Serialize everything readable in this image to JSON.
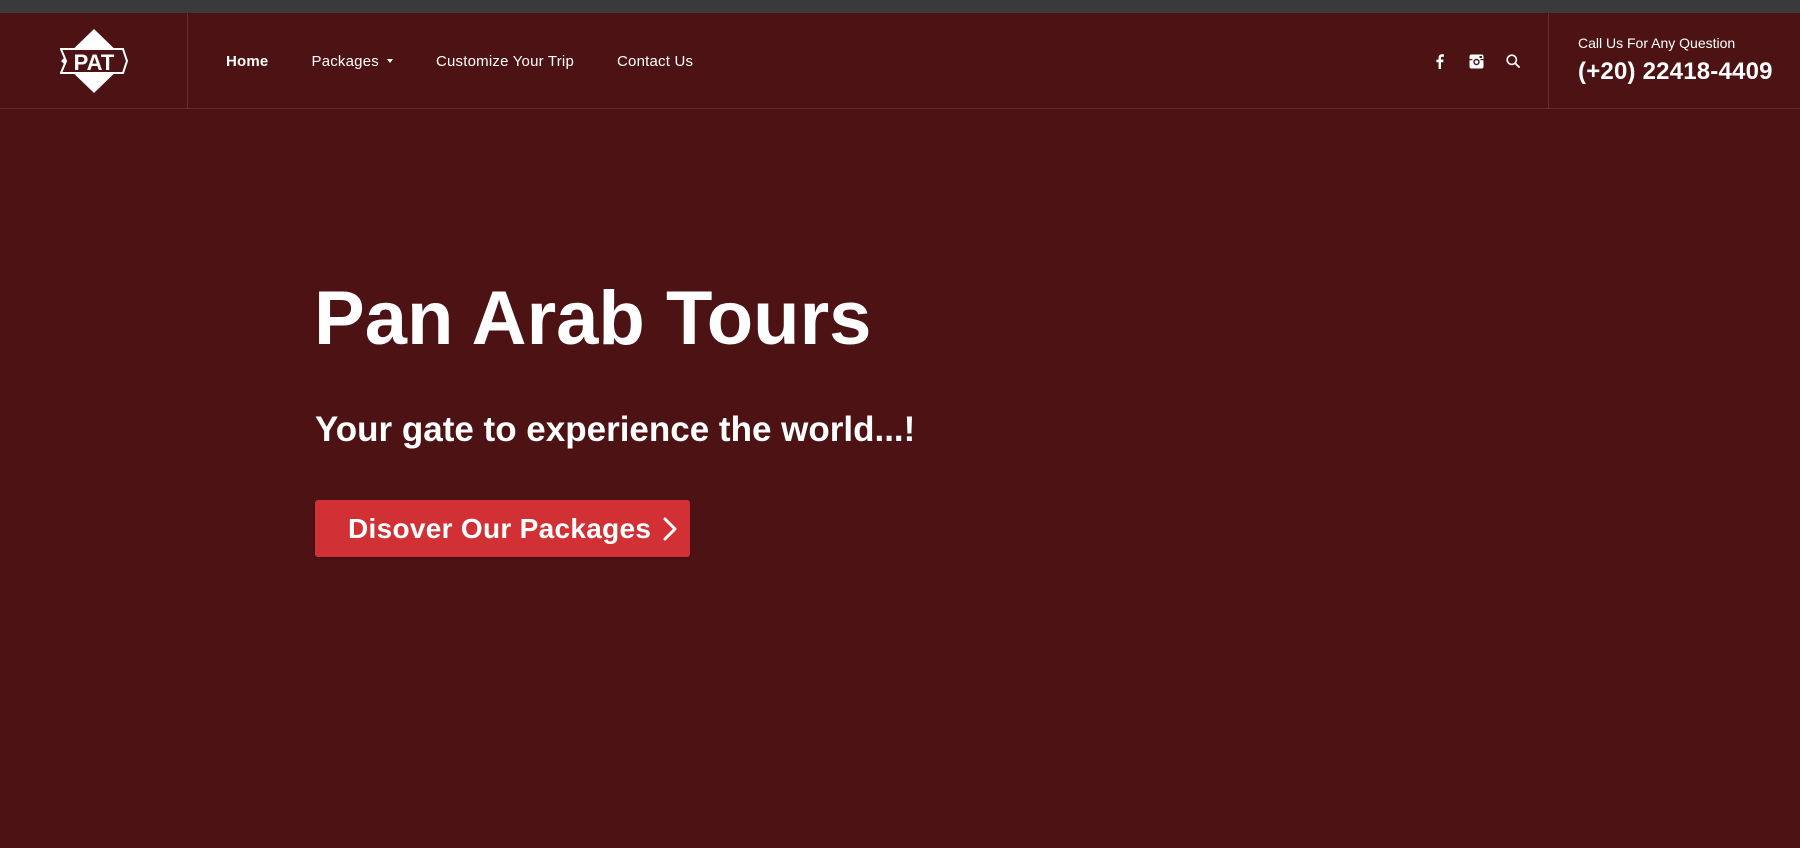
{
  "header": {
    "logo_text": "PAT",
    "nav": [
      {
        "label": "Home",
        "active": true
      },
      {
        "label": "Packages",
        "has_dropdown": true
      },
      {
        "label": "Customize Your Trip"
      },
      {
        "label": "Contact Us"
      }
    ],
    "icons": [
      "facebook-icon",
      "instagram-icon",
      "search-icon"
    ],
    "contact": {
      "label": "Call Us For Any Question",
      "phone": "(+20) 22418-4409"
    }
  },
  "hero": {
    "title": "Pan Arab Tours",
    "subtitle": "Your gate to experience the world...!",
    "cta_label": "Disover Our Packages"
  },
  "colors": {
    "background": "#4d1214",
    "accent": "#d13034",
    "topbar": "#3a3a3a",
    "text": "#ffffff"
  }
}
